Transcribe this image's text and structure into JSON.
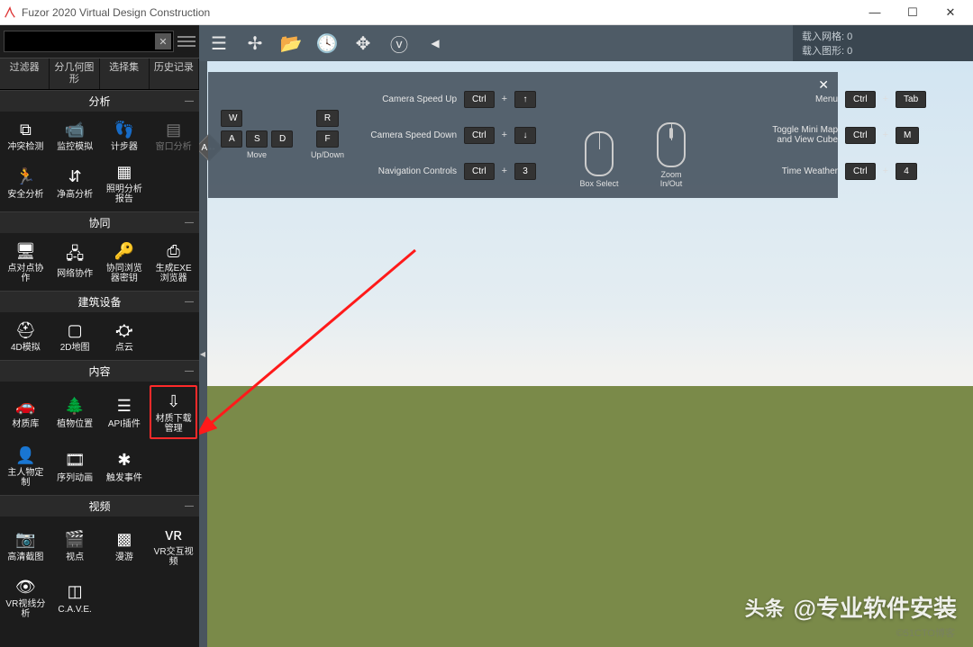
{
  "window": {
    "title": "Fuzor 2020 Virtual Design Construction"
  },
  "search": {
    "placeholder": ""
  },
  "tabs": [
    "过滤器",
    "分几何图\n形",
    "选择集",
    "历史记录"
  ],
  "sections": [
    {
      "title": "分析",
      "tools": [
        "冲突检测",
        "监控模拟",
        "计步器",
        "窗口分析",
        "安全分析",
        "净高分析",
        "照明分析\n报告"
      ]
    },
    {
      "title": "协同",
      "tools": [
        "点对点协\n作",
        "网络协作",
        "协同浏览\n器密钥",
        "生成EXE\n浏览器"
      ]
    },
    {
      "title": "建筑设备",
      "tools": [
        "4D模拟",
        "2D地图",
        "点云"
      ]
    },
    {
      "title": "内容",
      "tools": [
        "材质库",
        "植物位置",
        "API插件",
        "材质下载\n管理",
        "主人物定\n制",
        "序列动画",
        "触发事件"
      ],
      "highlight": 3
    },
    {
      "title": "视频",
      "tools": [
        "高清截图",
        "视点",
        "漫游",
        "VR交互视\n频",
        "VR视线分\n析",
        "C.A.V.E."
      ]
    }
  ],
  "status": {
    "grid": "载入网格: 0",
    "shape": "载入图形: 0"
  },
  "hints": {
    "move": "Move",
    "updown": "Up/Down",
    "rows": [
      {
        "label": "Camera Speed Up",
        "combo": [
          "Ctrl",
          "+",
          "↑"
        ]
      },
      {
        "label": "Camera Speed Down",
        "combo": [
          "Ctrl",
          "+",
          "↓"
        ]
      },
      {
        "label": "Navigation Controls",
        "combo": [
          "Ctrl",
          "+",
          "3"
        ]
      }
    ],
    "mouse1": "Box Select",
    "mouse2": "Zoom\nIn/Out",
    "rightrows": [
      {
        "label": "Menu",
        "combo": [
          "Ctrl",
          "+",
          "Tab"
        ]
      },
      {
        "label": "Toggle Mini Map\nand View Cube",
        "combo": [
          "Ctrl",
          "+",
          "M"
        ]
      },
      {
        "label": "Time Weather",
        "combo": [
          "Ctrl",
          "+",
          "4"
        ]
      }
    ]
  },
  "keys": {
    "w": "W",
    "a": "A",
    "s": "S",
    "d": "D",
    "r": "R",
    "f": "F"
  },
  "watermark": {
    "tag": "头条",
    "text": "@专业软件安装",
    "sub": "©51CTO博客"
  }
}
